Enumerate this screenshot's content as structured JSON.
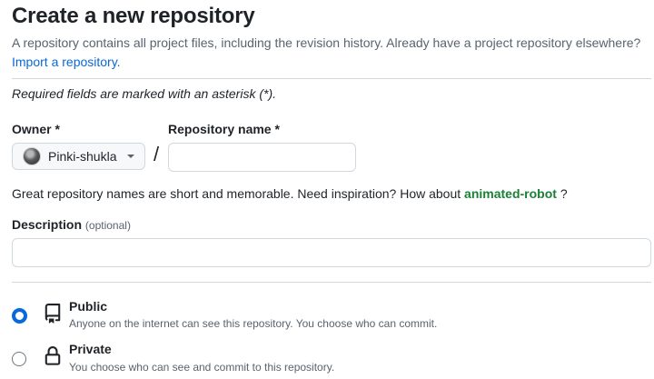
{
  "header": {
    "title": "Create a new repository",
    "subtitle": "A repository contains all project files, including the revision history. Already have a project repository elsewhere?",
    "import_link": "Import a repository."
  },
  "form": {
    "required_note": "Required fields are marked with an asterisk (*).",
    "owner_label": "Owner *",
    "owner_value": "Pinki-shukla",
    "slash": "/",
    "repo_name_label": "Repository name *",
    "repo_name_value": "",
    "inspiration_text": "Great repository names are short and memorable. Need inspiration? How about",
    "inspiration_suggestion": "animated-robot",
    "inspiration_end": "?",
    "description_label": "Description",
    "description_optional": "(optional)",
    "description_value": ""
  },
  "visibility": {
    "selected": "public",
    "options": [
      {
        "title": "Public",
        "description": "Anyone on the internet can see this repository. You choose who can commit.",
        "icon": "repo-icon",
        "checked": true
      },
      {
        "title": "Private",
        "description": "You choose who can see and commit to this repository.",
        "icon": "lock-icon",
        "checked": false
      }
    ]
  },
  "colors": {
    "link": "#0969da",
    "suggestion": "#1a7f37",
    "radio_selected": "#0969da",
    "muted_text": "#59636e"
  }
}
